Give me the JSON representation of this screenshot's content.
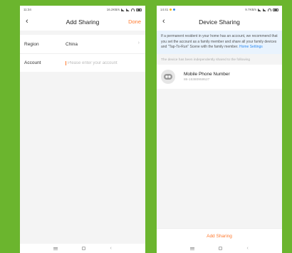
{
  "left": {
    "status": {
      "time": "11:34",
      "network": "16.2KB/s"
    },
    "nav": {
      "title": "Add Sharing",
      "done_label": "Done"
    },
    "form": {
      "region_label": "Region",
      "region_value": "China",
      "account_label": "Account",
      "account_placeholder": "Please enter your account"
    }
  },
  "right": {
    "status": {
      "time": "14:41",
      "network": "9.7KB/s"
    },
    "nav": {
      "title": "Device Sharing"
    },
    "info": {
      "text": "If a permanent resident in your home has an account, we recommend that you set the account as a family member and share all your family devices and \"Tap-To-Run\" Scene with the family member.",
      "link": "Home Settings"
    },
    "section_note": "The device has been independently shared to the following",
    "member": {
      "name": "Mobile Phone Number",
      "number": "86-15380959527"
    },
    "add_sharing_label": "Add Sharing"
  },
  "colors": {
    "background": "#6bb52e",
    "accent": "#ff7a2f",
    "link": "#2f8bf0",
    "info_bg": "#e9f3fd"
  },
  "icons": [
    "back-arrow-icon",
    "chevron-right-icon",
    "avatar-robot-icon",
    "menu-icon",
    "home-icon",
    "back-icon"
  ]
}
